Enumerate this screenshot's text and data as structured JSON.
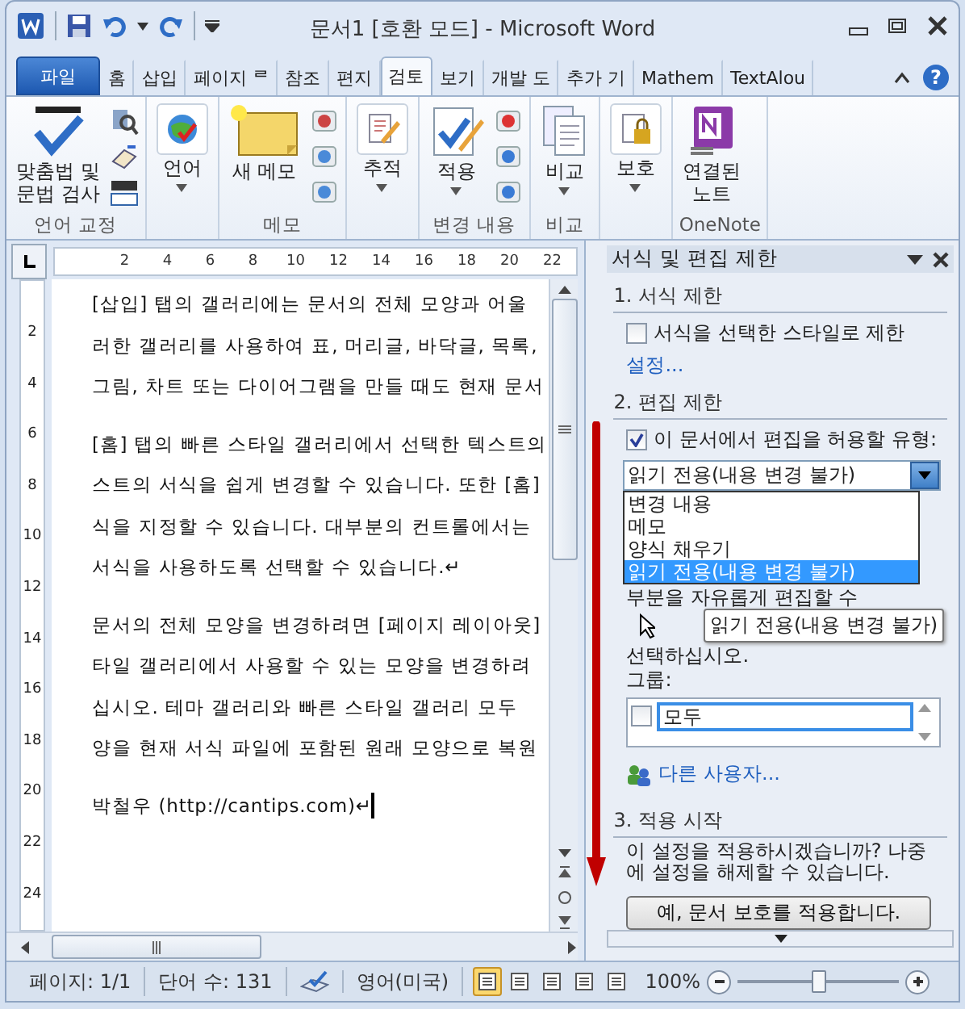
{
  "window": {
    "title": "문서1 [호환 모드] - Microsoft Word"
  },
  "tabs": [
    {
      "label": "파일",
      "kind": "file",
      "selected": false
    },
    {
      "label": "홈",
      "kind": "tab",
      "selected": false
    },
    {
      "label": "삽입",
      "kind": "tab",
      "selected": false
    },
    {
      "label": "페이지 ᄅ",
      "kind": "tab",
      "selected": false
    },
    {
      "label": "참조",
      "kind": "tab",
      "selected": false
    },
    {
      "label": "편지",
      "kind": "tab",
      "selected": false
    },
    {
      "label": "검토",
      "kind": "tab",
      "selected": true
    },
    {
      "label": "보기",
      "kind": "tab",
      "selected": false
    },
    {
      "label": "개발 도",
      "kind": "tab",
      "selected": false
    },
    {
      "label": "추가 기",
      "kind": "tab",
      "selected": false
    },
    {
      "label": "Mathem",
      "kind": "tab",
      "selected": false
    },
    {
      "label": "TextAlou",
      "kind": "tab",
      "selected": false
    }
  ],
  "help_button": "?",
  "ribbon_groups": [
    {
      "label": "언어 교정",
      "buttons": [
        {
          "label": "맞춤법 및\n문법 검사",
          "has_menu": false
        }
      ]
    },
    {
      "buttons": [
        {
          "label": "언어",
          "has_menu": true
        }
      ]
    },
    {
      "label": "메모",
      "buttons": [
        {
          "label": "새 메모",
          "has_menu": false
        }
      ]
    },
    {
      "buttons": [
        {
          "label": "추적",
          "has_menu": true
        }
      ]
    },
    {
      "label": "변경 내용",
      "buttons": [
        {
          "label": "적용",
          "has_menu": true
        }
      ]
    },
    {
      "label": "비교",
      "buttons": [
        {
          "label": "비교",
          "has_menu": true
        }
      ]
    },
    {
      "buttons": [
        {
          "label": "보호",
          "has_menu": true
        }
      ]
    },
    {
      "label": "OneNote",
      "buttons": [
        {
          "label": "연결된\n노트",
          "has_menu": false
        }
      ]
    }
  ],
  "ruler": {
    "marks": [
      "2",
      "4",
      "6",
      "8",
      "10",
      "12",
      "14",
      "16",
      "18",
      "20",
      "22"
    ]
  },
  "vertical_ruler": {
    "marks": [
      "2",
      "4",
      "6",
      "8",
      "10",
      "12",
      "14",
      "16",
      "18",
      "20",
      "22",
      "24"
    ]
  },
  "document": {
    "paragraphs": [
      {
        "lines": [
          "[삽입] 탭의 갤러리에는 문서의 전체 모양과 어울",
          "러한 갤러리를 사용하여 표, 머리글, 바닥글, 목록,",
          "그림, 차트 또는 다이어그램을 만들 때도 현재 문서"
        ]
      },
      {
        "lines": [
          "[홈] 탭의 빠른 스타일 갤러리에서 선택한 텍스트의",
          "스트의 서식을 쉽게 변경할 수 있습니다. 또한 [홈]",
          "식을 지정할 수 있습니다. 대부분의 컨트롤에서는",
          "서식을 사용하도록 선택할 수 있습니다.↵"
        ]
      },
      {
        "lines": [
          "문서의 전체 모양을 변경하려면 [페이지 레이아웃]",
          "타일 갤러리에서 사용할 수 있는 모양을 변경하려",
          "십시오. 테마 갤러리와 빠른 스타일 갤러리 모두",
          "양을 현재 서식 파일에 포함된 원래 모양으로 복원"
        ]
      },
      {
        "lines": [
          "박철우 (http://cantips.com)↵"
        ]
      }
    ]
  },
  "task_pane": {
    "title": "서식 및 편집 제한",
    "formatting": {
      "heading": "1. 서식 제한",
      "checkbox": {
        "label": "서식을 선택한 스타일로 제한",
        "checked": false
      },
      "link": "설정..."
    },
    "editing": {
      "heading": "2. 편집 제한",
      "checkbox": {
        "label": "이 문서에서 편집을 허용할 유형:",
        "checked": true
      },
      "select": {
        "value": "읽기 전용(내용 변경 불가)",
        "expanded": true,
        "options": [
          {
            "label": "변경 내용",
            "selected": false
          },
          {
            "label": "메모",
            "selected": false
          },
          {
            "label": "양식 채우기",
            "selected": false
          },
          {
            "label": "읽기 전용(내용 변경 불가)",
            "selected": true
          }
        ]
      },
      "exceptions_lines": [
        "부분을 자유롭게 편집할 수",
        "선택하십시오."
      ],
      "tooltip": "읽기 전용(내용 변경 불가)",
      "groups_label": "그룹:",
      "groups": [
        {
          "label": "모두",
          "checked": false
        }
      ],
      "link": "다른 사용자..."
    },
    "enforcement": {
      "heading": "3. 적용 시작",
      "text": "이 설정을 적용하시겠습니까? 나중에 설정을 해제할 수 있습니다.",
      "button": "예, 문서 보호를 적용합니다."
    }
  },
  "status_bar": {
    "page": "페이지: 1/1",
    "words": "단어 수: 131",
    "language": "영어(미국)",
    "zoom": "100%",
    "zoom_slider": {
      "level": 0.5
    },
    "views": [
      {
        "selected": true
      },
      {
        "selected": false
      },
      {
        "selected": false
      },
      {
        "selected": false
      },
      {
        "selected": false
      }
    ]
  }
}
